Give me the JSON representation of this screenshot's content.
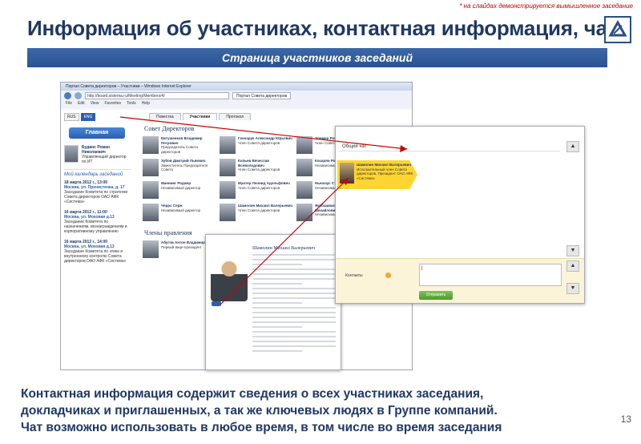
{
  "disclaimer": "* на слайдах демонстрируется вымышленное заседание",
  "title": "Информация об участниках, контактная информация, чат",
  "subtitle": "Страница участников заседаний",
  "browser": {
    "window_title": "Портал Совета директоров – Участники – Windows Internet Explorer",
    "url": "http://board.sistema.ru/Meeting/Members/4/",
    "tab_label": "Портал Совета директоров",
    "menu": [
      "File",
      "Edit",
      "View",
      "Favorites",
      "Tools",
      "Help"
    ],
    "lang": [
      "RUS",
      "ENG"
    ],
    "main_button": "Главная",
    "profile_name": "Буданс Роман Николаевич",
    "profile_role": "Управляющий директор по ИТ",
    "calendar_title": "Мой календарь заседаний",
    "events": [
      {
        "date": "18 марта 2012 г., 13:00",
        "place": "Москва, ул. Пречистенка, д. 17",
        "desc": "Заседание Комитета по стратегии Совета директоров ОАО АФК «Система»"
      },
      {
        "date": "16 марта 2012 г., 11:00",
        "place": "Москва, ул. Моховая д.13",
        "desc": "Заседание Комитета по назначениям, вознаграждениям и корпоративному управлению"
      },
      {
        "date": "16 марта 2012 г., 14:00",
        "place": "Москва, ул. Моховая д.13",
        "desc": "Заседание Комитета по этике и внутреннему контролю Совета директоров ОАО АФК «Система»"
      }
    ],
    "tabs": [
      "Повестка",
      "Участники",
      "Протокол"
    ],
    "board_title": "Совет Директоров",
    "board_members": [
      {
        "name": "Евтушенков Владимир Петрович",
        "role": "Председатель Совета директоров"
      },
      {
        "name": "Гончарук Александр Юрьевич",
        "role": "Член Совета директоров"
      },
      {
        "name": "Зоммер Рон",
        "role": "Член Совета директоров"
      },
      {
        "name": "Зубов Дмитрий Львович",
        "role": "Заместитель Председателя Совета"
      },
      {
        "name": "Копьев Вячеслав Всеволодович",
        "role": "Член Совета директоров"
      },
      {
        "name": "Кочарян Роберт Седракович",
        "role": "Независимый член Совета"
      },
      {
        "name": "Маннинг Роджер",
        "role": "Независимый директор"
      },
      {
        "name": "Мунтер Леонид Адольфович",
        "role": "Член Совета директоров"
      },
      {
        "name": "Ньюхаус Стэн",
        "role": "Независимый директор"
      },
      {
        "name": "Черрс Серж",
        "role": "Независимый директор"
      },
      {
        "name": "Шамолин Михаил Валерьевич",
        "role": "Член Совета директоров"
      },
      {
        "name": "Якобашвили Давид Михайлович",
        "role": "Независимый директор"
      }
    ],
    "management_title": "Члены правления",
    "management_members": [
      {
        "name": "Абугов Антон Владимирович",
        "role": "Первый вице-президент"
      },
      {
        "name": "Дроздов Сергей Алексеевич",
        "role": "Старший вице-президент"
      }
    ]
  },
  "chat": {
    "general_chat": "Общий чат",
    "card_name": "Шамолин Михаил Валерьевич",
    "card_role": "Исполнительный член Совета директоров, Президент ОАО АФК «Система»",
    "contacts_label": "Контакты",
    "send_button": "Отправить"
  },
  "popup": {
    "name": "Шамолин Михаил Валерьевич"
  },
  "bottom_text": [
    "Контактная информация содержит сведения о всех участниках заседания,",
    "докладчиках и приглашенных, а так же ключевых людях в Группе компаний.",
    "Чат возможно использовать в любое время, в том числе во время заседания"
  ],
  "page_number": "13",
  "colors": {
    "title": "#1f3864",
    "subbar": "#2b5290",
    "accent_yellow": "#ffd531",
    "arrow_red": "#cc0000"
  }
}
